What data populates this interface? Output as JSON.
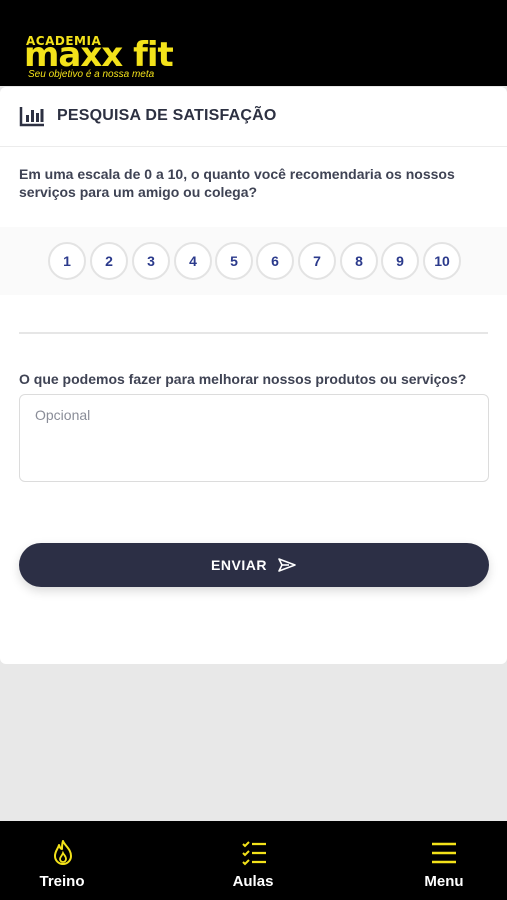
{
  "brand": {
    "name": "maxx fit",
    "prefix": "ACADEMIA",
    "tagline": "Seu objetivo é a nossa meta",
    "accent_color": "#f3e21a"
  },
  "survey": {
    "title": "PESQUISA DE SATISFAÇÃO",
    "title_icon": "bar-chart-icon",
    "question_1": "Em uma escala de 0 a 10, o quanto você recomendaria os nossos serviços para um amigo ou colega?",
    "scale": [
      "1",
      "2",
      "3",
      "4",
      "5",
      "6",
      "7",
      "8",
      "9",
      "10"
    ],
    "question_2": "O que podemos fazer para melhorar nossos produtos ou serviços?",
    "feedback_placeholder": "Opcional",
    "feedback_value": "",
    "submit_label": "ENVIAR",
    "submit_icon": "send-icon"
  },
  "nav": {
    "items": [
      {
        "label": "Treino",
        "icon": "flame-icon"
      },
      {
        "label": "Aulas",
        "icon": "checklist-icon"
      },
      {
        "label": "Menu",
        "icon": "hamburger-menu-icon"
      }
    ]
  }
}
